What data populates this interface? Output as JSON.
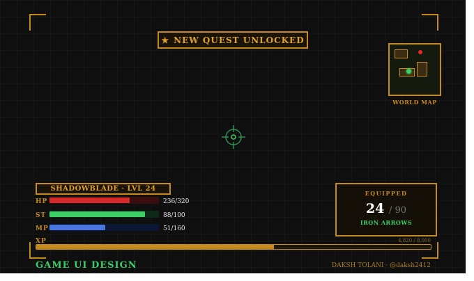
{
  "hud": {
    "quest_banner": "NEW QUEST UNLOCKED",
    "map_label": "WORLD MAP",
    "player_plate": "SHADOWBLADE · LVL 24"
  },
  "stats": [
    {
      "label": "HP",
      "value": "236/320",
      "fraction": 0.7375,
      "color": "#d22b2b",
      "track": "#3a0e0e"
    },
    {
      "label": "ST",
      "value": "88/100",
      "fraction": 0.88,
      "color": "#3ccf66",
      "track": "#0e2a16"
    },
    {
      "label": "MP",
      "value": "51/160",
      "fraction": 0.51,
      "color": "#4a76e0",
      "track": "#0e1636"
    }
  ],
  "equipped": {
    "title": "EQUIPPED",
    "count": "24",
    "max": "/ 90",
    "item": "IRON ARROWS"
  },
  "xp": {
    "label": "XP",
    "value": "4,820 / 8,000",
    "fraction": 0.6025
  },
  "footer": {
    "title": "GAME UI DESIGN",
    "credit": "DAKSH TOLANI · @daksh2412"
  },
  "colors": {
    "accent": "#c58a1c",
    "green": "#3ccf66",
    "background": "#0f0f0f"
  },
  "icons": {
    "quest": "star-icon",
    "center": "crosshair-icon",
    "player_marker": "green-dot",
    "objective_marker": "red-dot"
  }
}
